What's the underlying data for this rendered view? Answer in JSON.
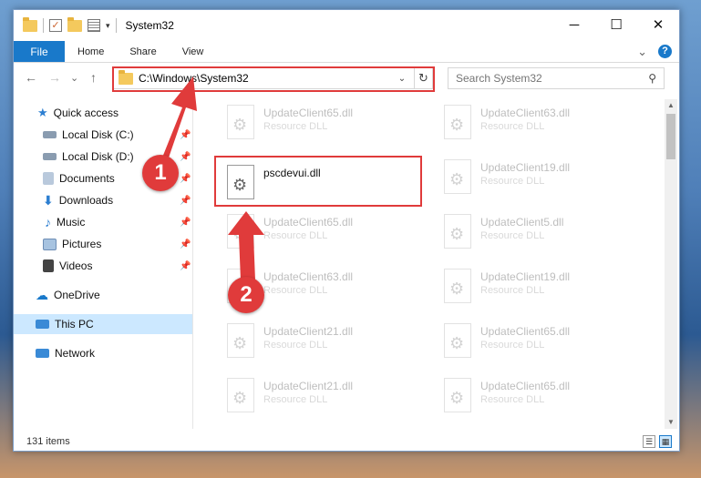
{
  "window": {
    "title": "System32",
    "controls": {
      "minimize": "─",
      "maximize": "☐",
      "close": "✕"
    }
  },
  "ribbon": {
    "file_label": "File",
    "tabs": [
      "Home",
      "Share",
      "View"
    ],
    "expand_glyph": "⌄",
    "help_glyph": "?"
  },
  "nav": {
    "back": "←",
    "forward": "→",
    "recent": "⌄",
    "up": "↑"
  },
  "address": {
    "path": "C:\\Windows\\System32",
    "dropdown": "⌄",
    "refresh": "↻"
  },
  "search": {
    "placeholder": "Search System32",
    "icon_glyph": "⚲"
  },
  "sidebar": {
    "items": [
      {
        "label": "Quick access",
        "icon": "star-icon",
        "color": "#2d7fd1",
        "pinned": false
      },
      {
        "label": "Local Disk (C:)",
        "icon": "drive-icon",
        "color": "#5a6f87",
        "pinned": true
      },
      {
        "label": "Local Disk (D:)",
        "icon": "drive-icon",
        "color": "#5a6f87",
        "pinned": true
      },
      {
        "label": "Documents",
        "icon": "documents-icon",
        "color": "#6d8db5",
        "pinned": true
      },
      {
        "label": "Downloads",
        "icon": "downloads-icon",
        "color": "#2d7fd1",
        "pinned": true
      },
      {
        "label": "Music",
        "icon": "music-icon",
        "color": "#2d7fd1",
        "pinned": true
      },
      {
        "label": "Pictures",
        "icon": "pictures-icon",
        "color": "#7fa6cf",
        "pinned": true
      },
      {
        "label": "Videos",
        "icon": "videos-icon",
        "color": "#444444",
        "pinned": true
      },
      {
        "label": "OneDrive",
        "icon": "onedrive-icon",
        "color": "#1979ca",
        "pinned": false
      },
      {
        "label": "This PC",
        "icon": "computer-icon",
        "color": "#3a8ad6",
        "pinned": false
      },
      {
        "label": "Network",
        "icon": "network-icon",
        "color": "#3a8ad6",
        "pinned": false
      }
    ],
    "pin_glyph": "📌"
  },
  "files": {
    "left": [
      {
        "name": "UpdateClient65.dll",
        "type": "Resource DLL"
      },
      {
        "name": "pscdevui.dll",
        "type": ""
      },
      {
        "name": "UpdateClient65.dll",
        "type": "Resource DLL"
      },
      {
        "name": "UpdateClient63.dll",
        "type": "Resource DLL"
      },
      {
        "name": "UpdateClient21.dll",
        "type": "Resource DLL"
      },
      {
        "name": "UpdateClient21.dll",
        "type": "Resource DLL"
      }
    ],
    "right": [
      {
        "name": "UpdateClient63.dll",
        "type": "Resource DLL"
      },
      {
        "name": "UpdateClient19.dll",
        "type": "Resource DLL"
      },
      {
        "name": "UpdateClient5.dll",
        "type": "Resource DLL"
      },
      {
        "name": "UpdateClient19.dll",
        "type": "Resource DLL"
      },
      {
        "name": "UpdateClient65.dll",
        "type": "Resource DLL"
      },
      {
        "name": "UpdateClient65.dll",
        "type": "Resource DLL"
      }
    ]
  },
  "status": {
    "item_count": "131 items"
  },
  "annotations": {
    "step1": "1",
    "step2": "2",
    "color": "#e03b3b"
  }
}
